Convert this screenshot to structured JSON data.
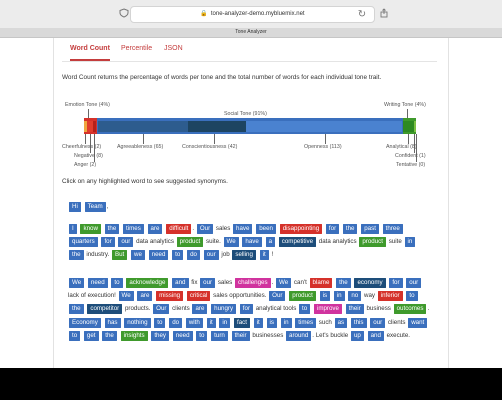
{
  "browser": {
    "url": "tone-analyzer-demo.mybluemix.net",
    "tab_title": "Tone Analyzer"
  },
  "tabs": [
    {
      "label": "Word Count",
      "active": true
    },
    {
      "label": "Percentile",
      "active": false
    },
    {
      "label": "JSON",
      "active": false
    }
  ],
  "description": "Word Count returns the percentage of words per tone and the total number of words for each individual tone trait.",
  "chart_data": {
    "type": "bar",
    "groups": [
      {
        "label": "Emotion Tone (4%)",
        "percent": 4,
        "color": "#d5312a"
      },
      {
        "label": "Social Tone (91%)",
        "percent": 91,
        "color": "#3a6fbd"
      },
      {
        "label": "Writing Tone (4%)",
        "percent": 4,
        "color": "#3f9a2c"
      }
    ],
    "traits": [
      {
        "label": "Cheerfulness (2)",
        "value": 2,
        "group": "Emotion"
      },
      {
        "label": "Negative (8)",
        "value": 8,
        "group": "Emotion"
      },
      {
        "label": "Anger (2)",
        "value": 2,
        "group": "Emotion"
      },
      {
        "label": "Agreeableness (65)",
        "value": 65,
        "group": "Social"
      },
      {
        "label": "Conscientiousness (42)",
        "value": 42,
        "group": "Social"
      },
      {
        "label": "Openness (113)",
        "value": 113,
        "group": "Social"
      },
      {
        "label": "Analytical (8)",
        "value": 8,
        "group": "Writing"
      },
      {
        "label": "Confident (1)",
        "value": 1,
        "group": "Writing"
      },
      {
        "label": "Tentative (0)",
        "value": 0,
        "group": "Writing"
      }
    ]
  },
  "hint": "Click on any highlighted word to see suggested synonyms.",
  "colors": {
    "social": "#3a6fbd",
    "emotion": "#d5312a",
    "writing": "#3f9a2c",
    "language": "#1d4d7a",
    "highlight_pink": "#d0339e",
    "tab_accent": "#c43d3d"
  },
  "paragraphs": [
    [
      [
        "Hi",
        "s"
      ],
      [
        " ",
        ""
      ],
      [
        "Team",
        "s"
      ],
      [
        ",",
        ""
      ]
    ],
    [
      [
        "I",
        "s"
      ],
      [
        " ",
        ""
      ],
      [
        "know",
        "w"
      ],
      [
        " ",
        ""
      ],
      [
        "the",
        "s"
      ],
      [
        " ",
        ""
      ],
      [
        "times",
        "s"
      ],
      [
        " ",
        ""
      ],
      [
        "are",
        "s"
      ],
      [
        " ",
        ""
      ],
      [
        "difficult",
        "e"
      ],
      [
        ". ",
        ""
      ],
      [
        "Our",
        "s"
      ],
      [
        " sales ",
        ""
      ],
      [
        "have",
        "s"
      ],
      [
        " ",
        ""
      ],
      [
        "been",
        "s"
      ],
      [
        " ",
        ""
      ],
      [
        "disappointing",
        "e"
      ],
      [
        " ",
        ""
      ],
      [
        "for",
        "s"
      ],
      [
        " ",
        ""
      ],
      [
        "the",
        "s"
      ],
      [
        " ",
        ""
      ],
      [
        "past",
        "s"
      ],
      [
        " ",
        ""
      ],
      [
        "three",
        "s"
      ],
      [
        " ",
        ""
      ],
      [
        "quarters",
        "s"
      ],
      [
        " ",
        ""
      ],
      [
        "for",
        "s"
      ],
      [
        " ",
        ""
      ],
      [
        "our",
        "s"
      ],
      [
        " data analytics ",
        ""
      ],
      [
        "product",
        "w"
      ],
      [
        " suite. ",
        ""
      ],
      [
        "We",
        "s"
      ],
      [
        " ",
        ""
      ],
      [
        "have",
        "s"
      ],
      [
        " ",
        ""
      ],
      [
        "a",
        "s"
      ],
      [
        " ",
        ""
      ],
      [
        "competitive",
        "l"
      ],
      [
        " data analytics ",
        ""
      ],
      [
        "product",
        "w"
      ],
      [
        " suite ",
        ""
      ],
      [
        "in",
        "s"
      ],
      [
        " ",
        ""
      ],
      [
        "the",
        "s"
      ],
      [
        " industry. ",
        ""
      ],
      [
        "But",
        "w"
      ],
      [
        " ",
        ""
      ],
      [
        "we",
        "s"
      ],
      [
        " ",
        ""
      ],
      [
        "need",
        "s"
      ],
      [
        " ",
        ""
      ],
      [
        "to",
        "s"
      ],
      [
        " ",
        ""
      ],
      [
        "do",
        "s"
      ],
      [
        " ",
        ""
      ],
      [
        "our",
        "s"
      ],
      [
        " job ",
        ""
      ],
      [
        "selling",
        "l"
      ],
      [
        " ",
        ""
      ],
      [
        "it",
        "s"
      ],
      [
        " ",
        ""
      ],
      [
        "!",
        ""
      ]
    ],
    [
      [
        "We",
        "s"
      ],
      [
        " ",
        ""
      ],
      [
        "need",
        "s"
      ],
      [
        " ",
        ""
      ],
      [
        "to",
        "s"
      ],
      [
        " ",
        ""
      ],
      [
        "acknowledge",
        "w"
      ],
      [
        " ",
        ""
      ],
      [
        "and",
        "s"
      ],
      [
        " fix ",
        ""
      ],
      [
        "our",
        "s"
      ],
      [
        " sales ",
        ""
      ],
      [
        "challenges",
        "p"
      ],
      [
        ". ",
        ""
      ],
      [
        "We",
        "s"
      ],
      [
        " can't ",
        ""
      ],
      [
        "blame",
        "e"
      ],
      [
        " ",
        ""
      ],
      [
        "the",
        "s"
      ],
      [
        " ",
        ""
      ],
      [
        "economy",
        "l"
      ],
      [
        " ",
        ""
      ],
      [
        "for",
        "s"
      ],
      [
        " ",
        ""
      ],
      [
        "our",
        "s"
      ],
      [
        " lack of execution! ",
        ""
      ],
      [
        "We",
        "s"
      ],
      [
        " ",
        ""
      ],
      [
        "are",
        "s"
      ],
      [
        " ",
        ""
      ],
      [
        "missing",
        "e"
      ],
      [
        " ",
        ""
      ],
      [
        "critical",
        "e"
      ],
      [
        " sales opportunities. ",
        ""
      ],
      [
        "Our",
        "s"
      ],
      [
        " ",
        ""
      ],
      [
        "product",
        "w"
      ],
      [
        " ",
        ""
      ],
      [
        "is",
        "s"
      ],
      [
        " ",
        ""
      ],
      [
        "in",
        "s"
      ],
      [
        " ",
        ""
      ],
      [
        "no",
        "s"
      ],
      [
        " way ",
        ""
      ],
      [
        "inferior",
        "e"
      ],
      [
        " ",
        ""
      ],
      [
        "to",
        "s"
      ],
      [
        " ",
        ""
      ],
      [
        "the",
        "s"
      ],
      [
        " ",
        ""
      ],
      [
        "competitor",
        "l"
      ],
      [
        " products. ",
        ""
      ],
      [
        "Our",
        "s"
      ],
      [
        " clients ",
        ""
      ],
      [
        "are",
        "s"
      ],
      [
        " ",
        ""
      ],
      [
        "hungry",
        "s"
      ],
      [
        " ",
        ""
      ],
      [
        "for",
        "s"
      ],
      [
        " analytical tools ",
        ""
      ],
      [
        "to",
        "s"
      ],
      [
        " ",
        ""
      ],
      [
        "improve",
        "p"
      ],
      [
        " ",
        ""
      ],
      [
        "their",
        "s"
      ],
      [
        " business ",
        ""
      ],
      [
        "outcomes",
        "w"
      ],
      [
        ". ",
        ""
      ],
      [
        "Economy",
        "s"
      ],
      [
        " ",
        ""
      ],
      [
        "has",
        "s"
      ],
      [
        " ",
        ""
      ],
      [
        "nothing",
        "s"
      ],
      [
        " ",
        ""
      ],
      [
        "to",
        "s"
      ],
      [
        " ",
        ""
      ],
      [
        "do",
        "s"
      ],
      [
        " ",
        ""
      ],
      [
        "with",
        "s"
      ],
      [
        " ",
        ""
      ],
      [
        "it",
        "s"
      ],
      [
        " ",
        ""
      ],
      [
        "in",
        "s"
      ],
      [
        " ",
        ""
      ],
      [
        "fact",
        "l"
      ],
      [
        " ",
        ""
      ],
      [
        "it",
        "s"
      ],
      [
        " ",
        ""
      ],
      [
        "is",
        "s"
      ],
      [
        " ",
        ""
      ],
      [
        "in",
        "s"
      ],
      [
        " ",
        ""
      ],
      [
        "times",
        "s"
      ],
      [
        " such ",
        ""
      ],
      [
        "as",
        "s"
      ],
      [
        " ",
        ""
      ],
      [
        "this",
        "s"
      ],
      [
        " ",
        ""
      ],
      [
        "our",
        "s"
      ],
      [
        " clients ",
        ""
      ],
      [
        "want",
        "s"
      ],
      [
        " ",
        ""
      ],
      [
        "to",
        "s"
      ],
      [
        " ",
        ""
      ],
      [
        "get",
        "s"
      ],
      [
        " ",
        ""
      ],
      [
        "the",
        "s"
      ],
      [
        " ",
        ""
      ],
      [
        "insights",
        "w"
      ],
      [
        " ",
        ""
      ],
      [
        "they",
        "s"
      ],
      [
        " ",
        ""
      ],
      [
        "need",
        "s"
      ],
      [
        " ",
        ""
      ],
      [
        "to",
        "s"
      ],
      [
        " ",
        ""
      ],
      [
        "turn",
        "s"
      ],
      [
        " ",
        ""
      ],
      [
        "their",
        "s"
      ],
      [
        " businesses ",
        ""
      ],
      [
        "around",
        "s"
      ],
      [
        ". Let's buckle ",
        ""
      ],
      [
        "up",
        "s"
      ],
      [
        " ",
        ""
      ],
      [
        "and",
        "s"
      ],
      [
        " execute.",
        ""
      ]
    ]
  ]
}
